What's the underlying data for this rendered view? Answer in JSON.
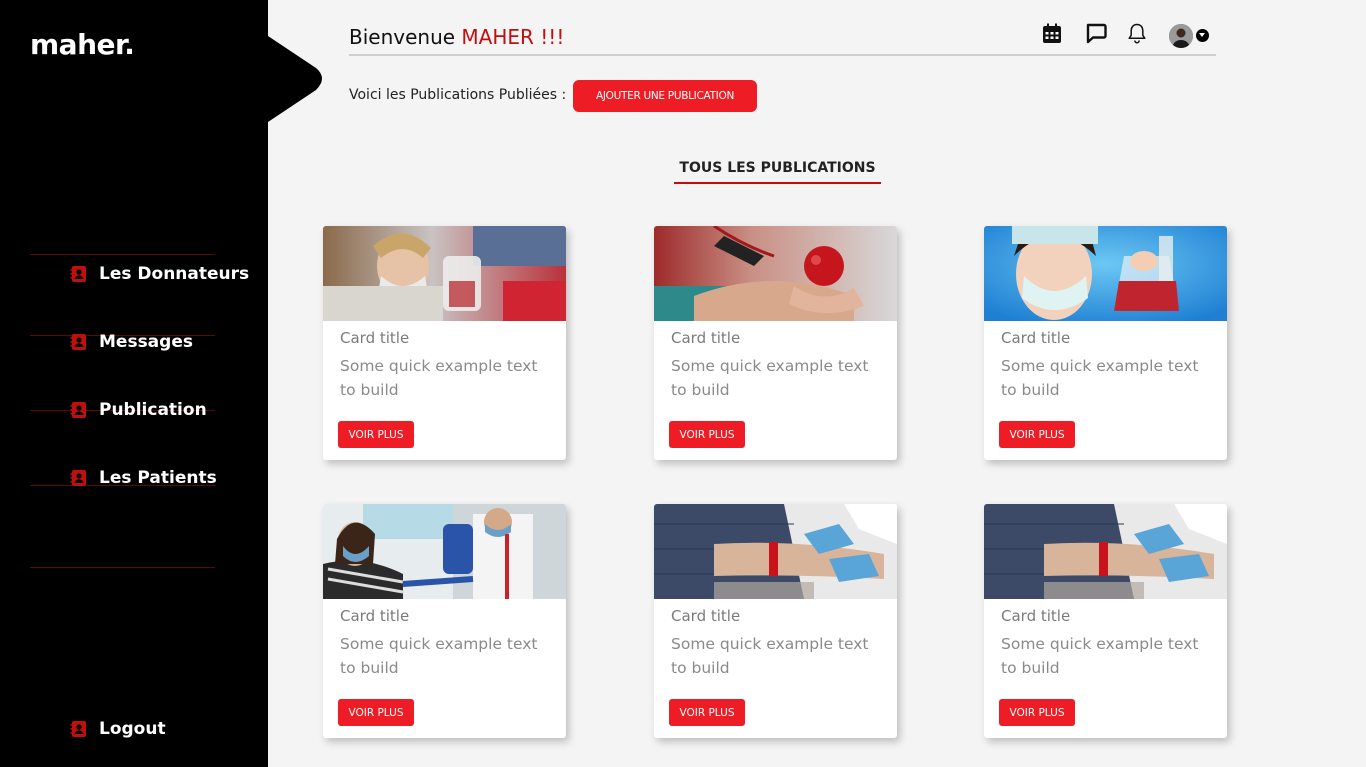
{
  "sidebar": {
    "logo": "maher.",
    "items": [
      {
        "label": "Les Donnateurs",
        "icon": "contact-book-icon"
      },
      {
        "label": "Messages",
        "icon": "contact-book-icon"
      },
      {
        "label": "Publication",
        "icon": "contact-book-icon"
      },
      {
        "label": "Les Patients",
        "icon": "contact-book-icon"
      }
    ],
    "logout": {
      "label": "Logout",
      "icon": "contact-book-icon"
    }
  },
  "header": {
    "welcome": "Bienvenue",
    "username": "MAHER !!!",
    "icons": [
      "calendar-icon",
      "message-icon",
      "bell-icon",
      "avatar",
      "caret-down-icon"
    ]
  },
  "main": {
    "subtitle": "Voici les Publications Publiées :",
    "add_button": "AJOUTER UNE PUBLICATION",
    "section_title": "TOUS LES PUBLICATIONS",
    "cards": [
      {
        "title": "Card title",
        "text": "Some quick example text to build",
        "button": "VOIR PLUS",
        "image": "blood-bag-nurse"
      },
      {
        "title": "Card title",
        "text": "Some quick example text to build",
        "button": "VOIR PLUS",
        "image": "heart-donation-arm"
      },
      {
        "title": "Card title",
        "text": "Some quick example text to build",
        "button": "VOIR PLUS",
        "image": "nurse-blood-bag-blue"
      },
      {
        "title": "Card title",
        "text": "Some quick example text to build",
        "button": "VOIR PLUS",
        "image": "donor-patient-chair"
      },
      {
        "title": "Card title",
        "text": "Some quick example text to build",
        "button": "VOIR PLUS",
        "image": "arm-tourniquet-gloves"
      },
      {
        "title": "Card title",
        "text": "Some quick example text to build",
        "button": "VOIR PLUS",
        "image": "arm-tourniquet-gloves"
      }
    ]
  },
  "colors": {
    "accent": "#ee1c25",
    "dark_red": "#c10e0e",
    "sidebar_bg": "#000000",
    "page_bg": "#f4f4f4"
  }
}
